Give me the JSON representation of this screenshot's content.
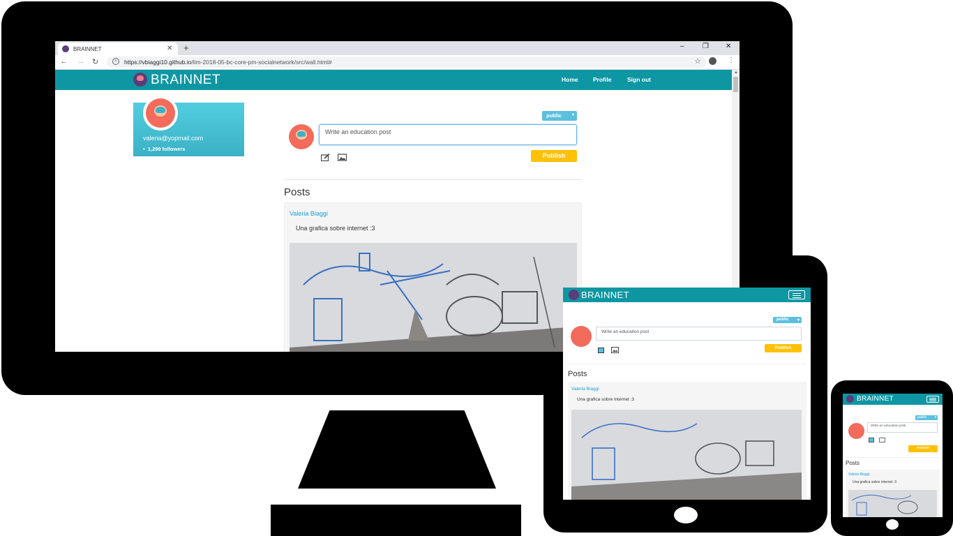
{
  "browser": {
    "tab_title": "BRAINNET",
    "tab_close": "✕",
    "new_tab": "+",
    "url_host": "https://vbiaggi10.github.io",
    "url_path": "/lim-2018-05-bc-core-pm-socialnetwork/src/wall.html#",
    "window_controls": [
      "–",
      "❐",
      "✕"
    ],
    "nav_icons": [
      "←",
      "→",
      "↻"
    ]
  },
  "app": {
    "brand": "BRAINNET",
    "nav": [
      "Home",
      "Profile",
      "Sign out"
    ],
    "accent_color": "#0e97a3",
    "publish_color": "#ffc107"
  },
  "profile": {
    "email": "valeria@yopmail.com",
    "followers": "1,299 followers",
    "bullet": "•"
  },
  "composer": {
    "privacy": "public",
    "privacy_caret": "▾",
    "placeholder": "Write an education post",
    "publish_label": "Publish"
  },
  "feed": {
    "section_title": "Posts",
    "posts": [
      {
        "author": "Valeria Biaggi",
        "text": "Una grafica sobre internet :3"
      }
    ]
  },
  "icons": [
    "brain-logo-icon",
    "edit-icon",
    "image-icon",
    "star-icon",
    "account-icon",
    "hamburger-menu-icon"
  ]
}
